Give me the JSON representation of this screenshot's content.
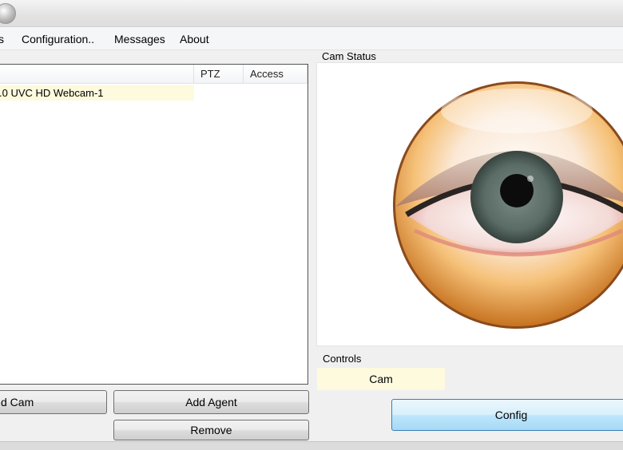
{
  "menu": {
    "items": [
      {
        "label": "s"
      },
      {
        "label": "Configuration.."
      },
      {
        "label": "Messages"
      },
      {
        "label": "About"
      }
    ]
  },
  "cams_list": {
    "columns": {
      "name": "",
      "ptz": "PTZ",
      "access": "Access"
    },
    "rows": [
      {
        "name": ".0 UVC HD Webcam-1",
        "ptz": "",
        "access": ""
      }
    ]
  },
  "buttons": {
    "add_cam": "d Cam",
    "add_agent": "Add Agent",
    "remove": "Remove"
  },
  "status": {
    "label": "Cam Status",
    "icon": "eye-icon"
  },
  "controls": {
    "label": "Controls",
    "cam_label": "Cam",
    "config_button": "Config"
  }
}
